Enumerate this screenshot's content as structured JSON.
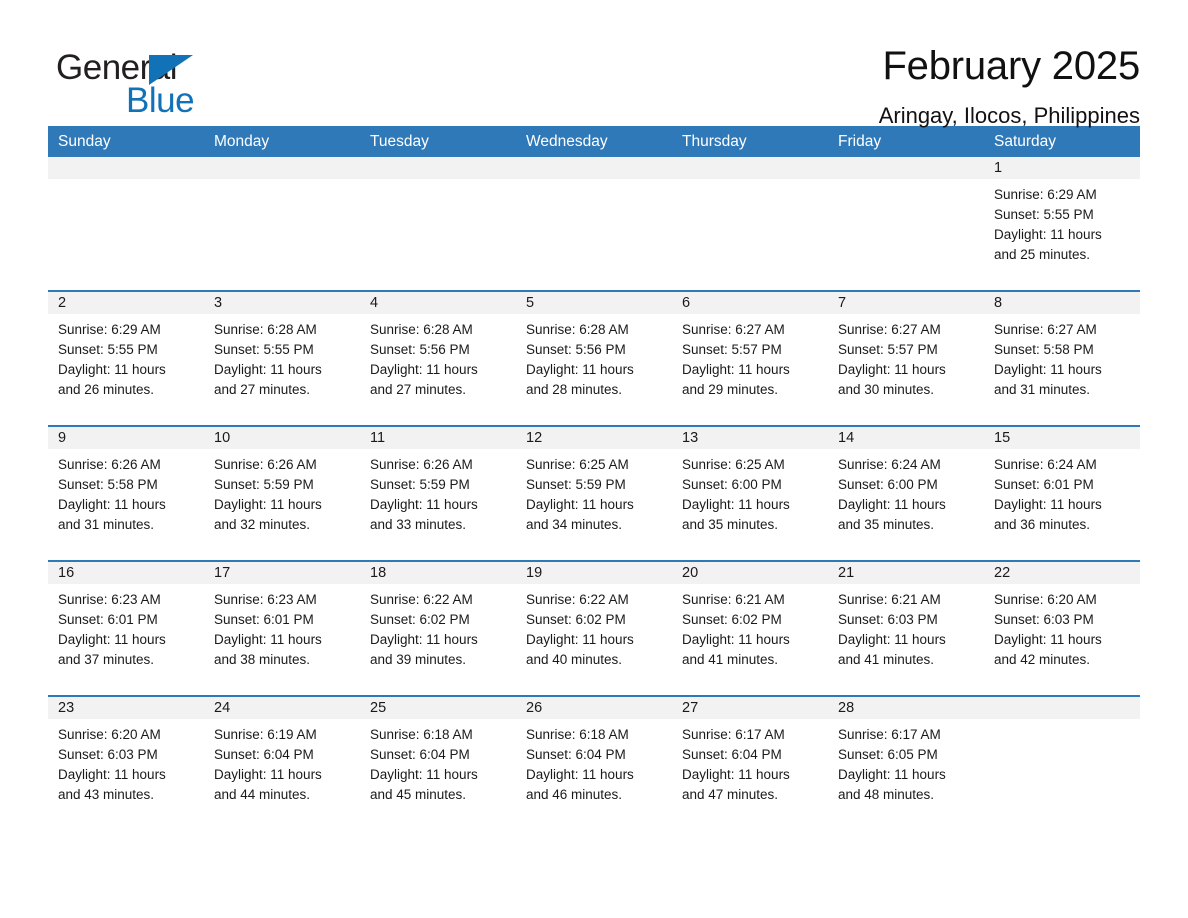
{
  "logo": {
    "word1": "General",
    "word2": "Blue",
    "triangle_color": "#1272b8"
  },
  "header": {
    "title": "February 2025",
    "subtitle": "Aringay, Ilocos, Philippines"
  },
  "theme": {
    "header_blue": "#2f79b9",
    "daynum_strip": "#f2f2f2",
    "text": "#1a1a1a"
  },
  "weekdays": [
    "Sunday",
    "Monday",
    "Tuesday",
    "Wednesday",
    "Thursday",
    "Friday",
    "Saturday"
  ],
  "weeks": [
    [
      {
        "day": "",
        "sunrise": "",
        "sunset": "",
        "daylight": "",
        "daylight2": ""
      },
      {
        "day": "",
        "sunrise": "",
        "sunset": "",
        "daylight": "",
        "daylight2": ""
      },
      {
        "day": "",
        "sunrise": "",
        "sunset": "",
        "daylight": "",
        "daylight2": ""
      },
      {
        "day": "",
        "sunrise": "",
        "sunset": "",
        "daylight": "",
        "daylight2": ""
      },
      {
        "day": "",
        "sunrise": "",
        "sunset": "",
        "daylight": "",
        "daylight2": ""
      },
      {
        "day": "",
        "sunrise": "",
        "sunset": "",
        "daylight": "",
        "daylight2": ""
      },
      {
        "day": "1",
        "sunrise": "Sunrise: 6:29 AM",
        "sunset": "Sunset: 5:55 PM",
        "daylight": "Daylight: 11 hours",
        "daylight2": "and 25 minutes."
      }
    ],
    [
      {
        "day": "2",
        "sunrise": "Sunrise: 6:29 AM",
        "sunset": "Sunset: 5:55 PM",
        "daylight": "Daylight: 11 hours",
        "daylight2": "and 26 minutes."
      },
      {
        "day": "3",
        "sunrise": "Sunrise: 6:28 AM",
        "sunset": "Sunset: 5:55 PM",
        "daylight": "Daylight: 11 hours",
        "daylight2": "and 27 minutes."
      },
      {
        "day": "4",
        "sunrise": "Sunrise: 6:28 AM",
        "sunset": "Sunset: 5:56 PM",
        "daylight": "Daylight: 11 hours",
        "daylight2": "and 27 minutes."
      },
      {
        "day": "5",
        "sunrise": "Sunrise: 6:28 AM",
        "sunset": "Sunset: 5:56 PM",
        "daylight": "Daylight: 11 hours",
        "daylight2": "and 28 minutes."
      },
      {
        "day": "6",
        "sunrise": "Sunrise: 6:27 AM",
        "sunset": "Sunset: 5:57 PM",
        "daylight": "Daylight: 11 hours",
        "daylight2": "and 29 minutes."
      },
      {
        "day": "7",
        "sunrise": "Sunrise: 6:27 AM",
        "sunset": "Sunset: 5:57 PM",
        "daylight": "Daylight: 11 hours",
        "daylight2": "and 30 minutes."
      },
      {
        "day": "8",
        "sunrise": "Sunrise: 6:27 AM",
        "sunset": "Sunset: 5:58 PM",
        "daylight": "Daylight: 11 hours",
        "daylight2": "and 31 minutes."
      }
    ],
    [
      {
        "day": "9",
        "sunrise": "Sunrise: 6:26 AM",
        "sunset": "Sunset: 5:58 PM",
        "daylight": "Daylight: 11 hours",
        "daylight2": "and 31 minutes."
      },
      {
        "day": "10",
        "sunrise": "Sunrise: 6:26 AM",
        "sunset": "Sunset: 5:59 PM",
        "daylight": "Daylight: 11 hours",
        "daylight2": "and 32 minutes."
      },
      {
        "day": "11",
        "sunrise": "Sunrise: 6:26 AM",
        "sunset": "Sunset: 5:59 PM",
        "daylight": "Daylight: 11 hours",
        "daylight2": "and 33 minutes."
      },
      {
        "day": "12",
        "sunrise": "Sunrise: 6:25 AM",
        "sunset": "Sunset: 5:59 PM",
        "daylight": "Daylight: 11 hours",
        "daylight2": "and 34 minutes."
      },
      {
        "day": "13",
        "sunrise": "Sunrise: 6:25 AM",
        "sunset": "Sunset: 6:00 PM",
        "daylight": "Daylight: 11 hours",
        "daylight2": "and 35 minutes."
      },
      {
        "day": "14",
        "sunrise": "Sunrise: 6:24 AM",
        "sunset": "Sunset: 6:00 PM",
        "daylight": "Daylight: 11 hours",
        "daylight2": "and 35 minutes."
      },
      {
        "day": "15",
        "sunrise": "Sunrise: 6:24 AM",
        "sunset": "Sunset: 6:01 PM",
        "daylight": "Daylight: 11 hours",
        "daylight2": "and 36 minutes."
      }
    ],
    [
      {
        "day": "16",
        "sunrise": "Sunrise: 6:23 AM",
        "sunset": "Sunset: 6:01 PM",
        "daylight": "Daylight: 11 hours",
        "daylight2": "and 37 minutes."
      },
      {
        "day": "17",
        "sunrise": "Sunrise: 6:23 AM",
        "sunset": "Sunset: 6:01 PM",
        "daylight": "Daylight: 11 hours",
        "daylight2": "and 38 minutes."
      },
      {
        "day": "18",
        "sunrise": "Sunrise: 6:22 AM",
        "sunset": "Sunset: 6:02 PM",
        "daylight": "Daylight: 11 hours",
        "daylight2": "and 39 minutes."
      },
      {
        "day": "19",
        "sunrise": "Sunrise: 6:22 AM",
        "sunset": "Sunset: 6:02 PM",
        "daylight": "Daylight: 11 hours",
        "daylight2": "and 40 minutes."
      },
      {
        "day": "20",
        "sunrise": "Sunrise: 6:21 AM",
        "sunset": "Sunset: 6:02 PM",
        "daylight": "Daylight: 11 hours",
        "daylight2": "and 41 minutes."
      },
      {
        "day": "21",
        "sunrise": "Sunrise: 6:21 AM",
        "sunset": "Sunset: 6:03 PM",
        "daylight": "Daylight: 11 hours",
        "daylight2": "and 41 minutes."
      },
      {
        "day": "22",
        "sunrise": "Sunrise: 6:20 AM",
        "sunset": "Sunset: 6:03 PM",
        "daylight": "Daylight: 11 hours",
        "daylight2": "and 42 minutes."
      }
    ],
    [
      {
        "day": "23",
        "sunrise": "Sunrise: 6:20 AM",
        "sunset": "Sunset: 6:03 PM",
        "daylight": "Daylight: 11 hours",
        "daylight2": "and 43 minutes."
      },
      {
        "day": "24",
        "sunrise": "Sunrise: 6:19 AM",
        "sunset": "Sunset: 6:04 PM",
        "daylight": "Daylight: 11 hours",
        "daylight2": "and 44 minutes."
      },
      {
        "day": "25",
        "sunrise": "Sunrise: 6:18 AM",
        "sunset": "Sunset: 6:04 PM",
        "daylight": "Daylight: 11 hours",
        "daylight2": "and 45 minutes."
      },
      {
        "day": "26",
        "sunrise": "Sunrise: 6:18 AM",
        "sunset": "Sunset: 6:04 PM",
        "daylight": "Daylight: 11 hours",
        "daylight2": "and 46 minutes."
      },
      {
        "day": "27",
        "sunrise": "Sunrise: 6:17 AM",
        "sunset": "Sunset: 6:04 PM",
        "daylight": "Daylight: 11 hours",
        "daylight2": "and 47 minutes."
      },
      {
        "day": "28",
        "sunrise": "Sunrise: 6:17 AM",
        "sunset": "Sunset: 6:05 PM",
        "daylight": "Daylight: 11 hours",
        "daylight2": "and 48 minutes."
      },
      {
        "day": "",
        "sunrise": "",
        "sunset": "",
        "daylight": "",
        "daylight2": ""
      }
    ]
  ]
}
